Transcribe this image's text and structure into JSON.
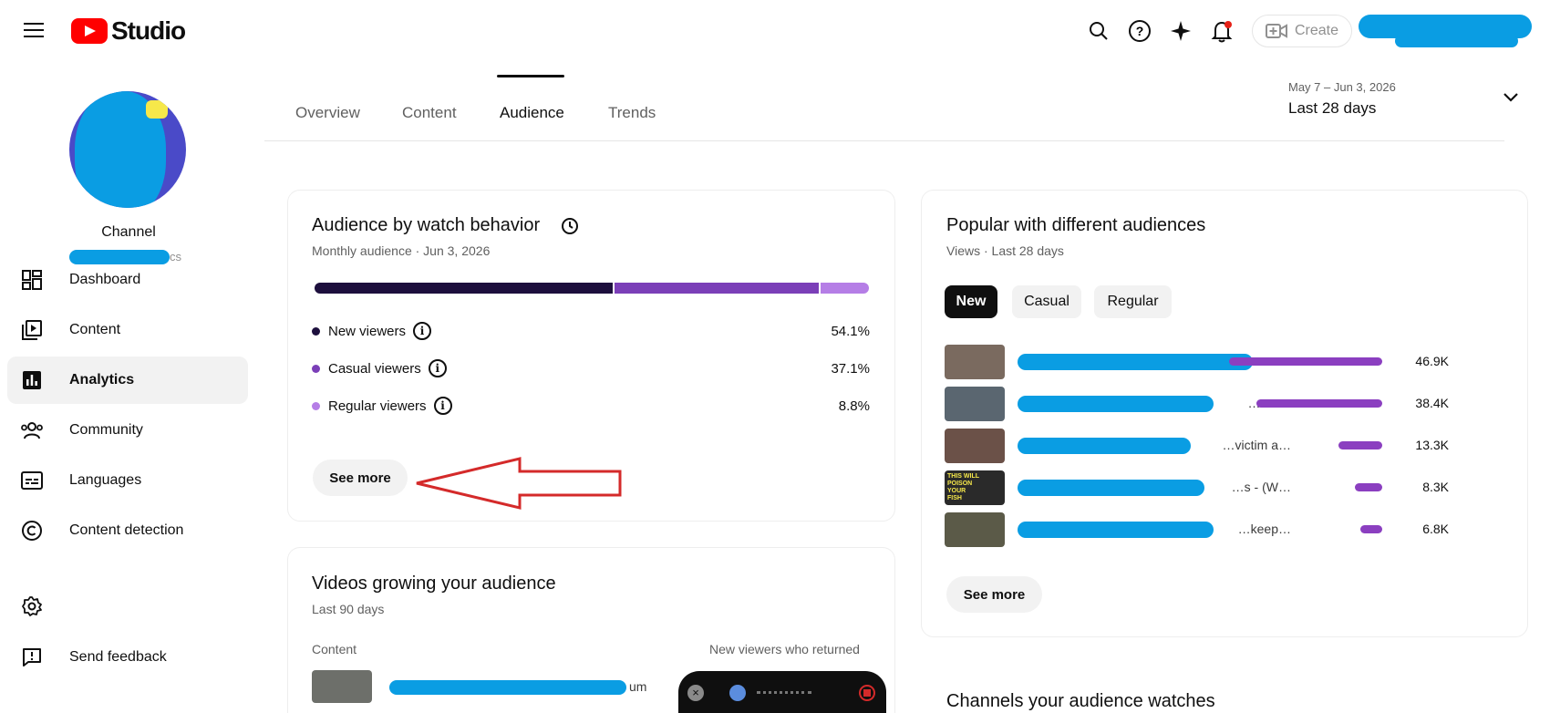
{
  "header": {
    "logo_text": "Studio",
    "create_label": "Create"
  },
  "sidebar": {
    "channel_label": "Channel",
    "channel_handle_tail": "cs",
    "items": [
      {
        "label": "Dashboard",
        "icon": "dashboard-icon"
      },
      {
        "label": "Content",
        "icon": "content-icon"
      },
      {
        "label": "Analytics",
        "icon": "analytics-icon",
        "active": true
      },
      {
        "label": "Community",
        "icon": "community-icon"
      },
      {
        "label": "Languages",
        "icon": "languages-icon"
      },
      {
        "label": "Content detection",
        "icon": "copyright-icon"
      },
      {
        "label": "",
        "icon": "settings-icon"
      },
      {
        "label": "Send feedback",
        "icon": "feedback-icon"
      }
    ]
  },
  "tabs": [
    {
      "label": "Overview"
    },
    {
      "label": "Content"
    },
    {
      "label": "Audience",
      "active": true
    },
    {
      "label": "Trends"
    }
  ],
  "daterange": {
    "range": "May 7 – Jun 3, 2026",
    "label": "Last 28 days"
  },
  "watch_behavior": {
    "title": "Audience by watch behavior",
    "subtitle": "Monthly audience · Jun 3, 2026",
    "segments": [
      {
        "name": "New viewers",
        "value": "54.1%",
        "fraction": 0.541,
        "color": "#1d0f3d"
      },
      {
        "name": "Casual viewers",
        "value": "37.1%",
        "fraction": 0.371,
        "color": "#7b3fb8"
      },
      {
        "name": "Regular viewers",
        "value": "8.8%",
        "fraction": 0.088,
        "color": "#b57ee6"
      }
    ],
    "see_more": "See more"
  },
  "popular": {
    "title": "Popular with different audiences",
    "subtitle": "Views · Last 28 days",
    "chips": [
      {
        "label": "New",
        "active": true
      },
      {
        "label": "Casual"
      },
      {
        "label": "Regular"
      }
    ],
    "rows": [
      {
        "title": "…",
        "views": "46.9K",
        "value": 46.9
      },
      {
        "title": "…ou …",
        "views": "38.4K",
        "value": 38.4
      },
      {
        "title": "…victim a…",
        "views": "13.3K",
        "value": 13.3
      },
      {
        "title": "…s - (W…",
        "views": "8.3K",
        "value": 8.3
      },
      {
        "title": "…keep…",
        "views": "6.8K",
        "value": 6.8
      }
    ],
    "see_more": "See more"
  },
  "growing": {
    "title": "Videos growing your audience",
    "subtitle": "Last 90 days",
    "col_content": "Content",
    "col_metric": "New viewers who returned",
    "row_tail": "um"
  },
  "channels": {
    "title": "Channels your audience watches"
  },
  "thumbnail_text": "THIS WILL POISON YOUR FISH"
}
